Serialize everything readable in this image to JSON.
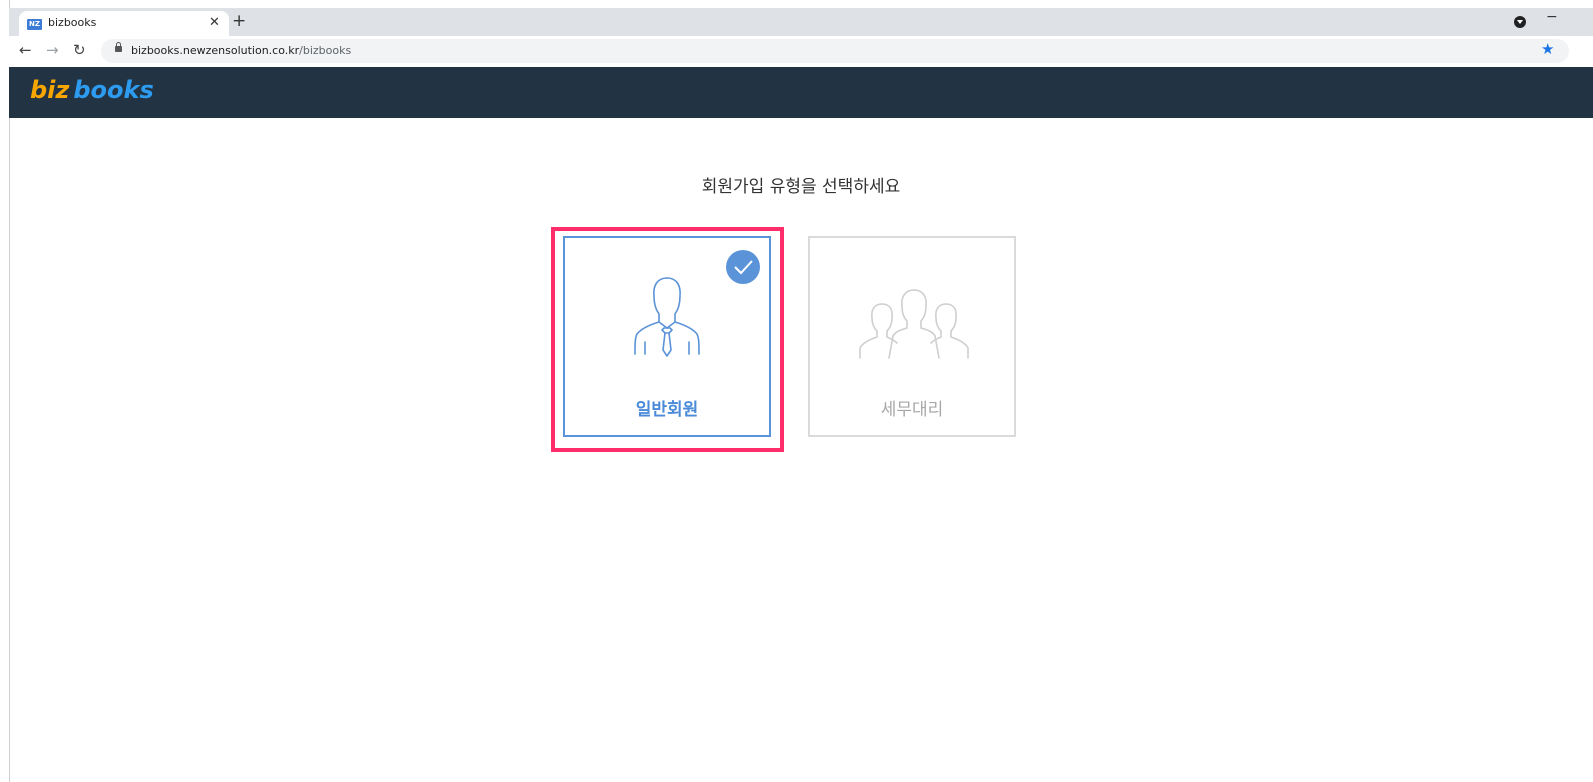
{
  "browser": {
    "tab_title": "bizbooks",
    "favicon_text": "NZ",
    "url_host": "bizbooks.newzensolution.co.kr",
    "url_path": "/bizbooks"
  },
  "header": {
    "logo_biz": "biz",
    "logo_books": "books"
  },
  "main": {
    "heading": "회원가입 유형을 선택하세요",
    "cards": [
      {
        "label": "일반회원",
        "selected": true,
        "icon": "person-tie-icon"
      },
      {
        "label": "세무대리",
        "selected": false,
        "icon": "group-icon"
      }
    ]
  },
  "colors": {
    "header_bg": "#223343",
    "selected_accent": "#5b93d8",
    "highlight_border": "#ff2d6a"
  }
}
